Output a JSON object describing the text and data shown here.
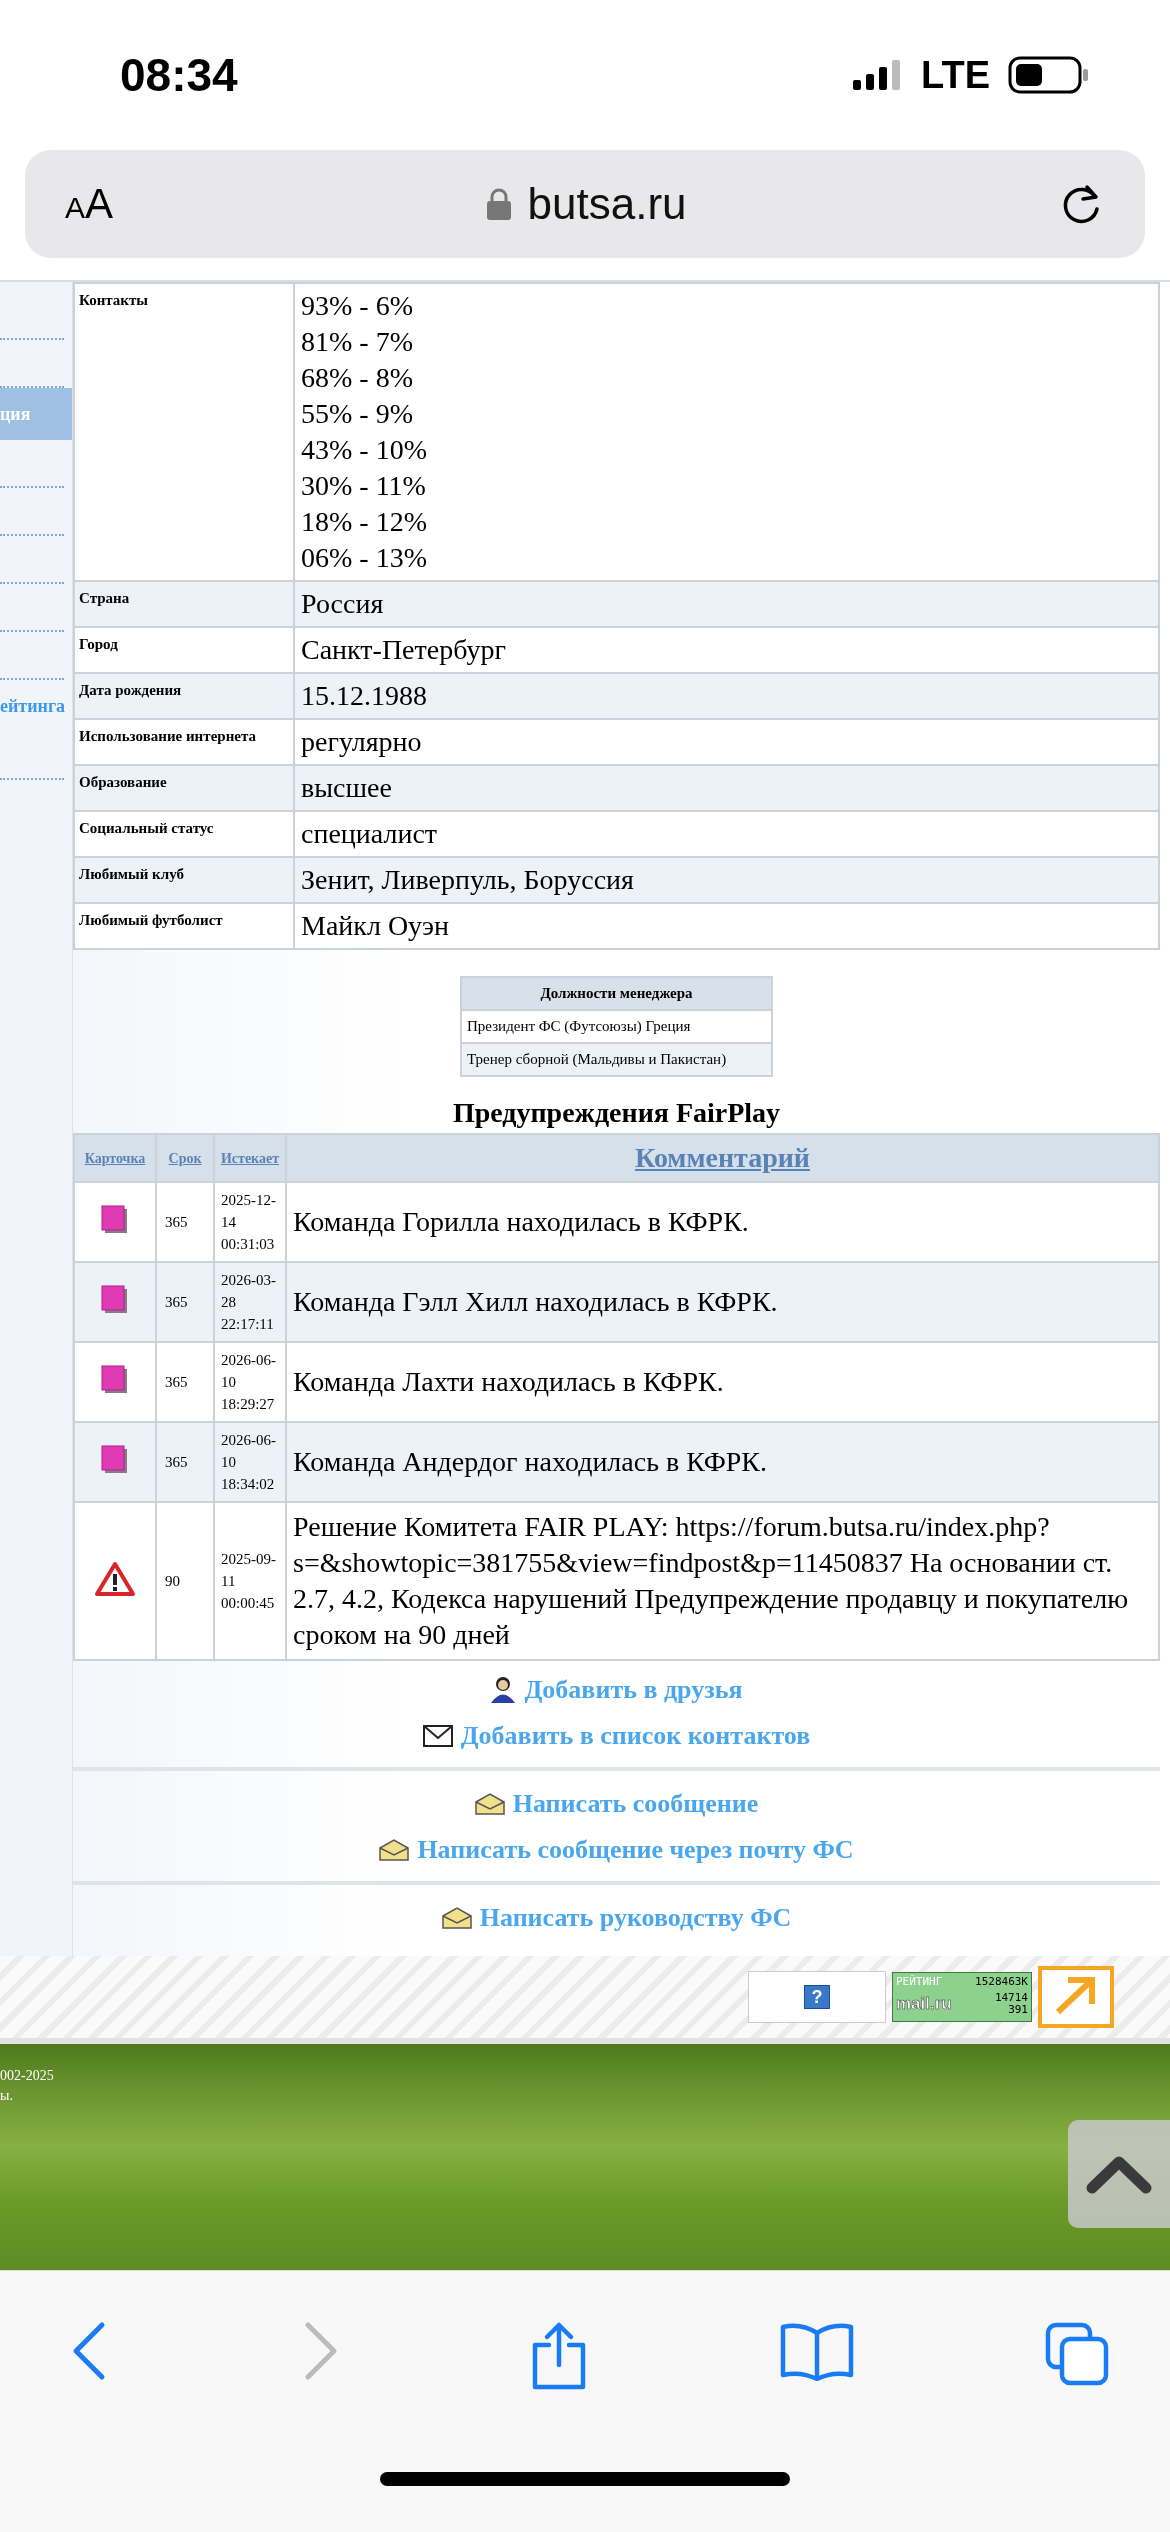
{
  "status_bar": {
    "time": "08:34",
    "network": "LTE"
  },
  "browser": {
    "text_size_button": "AA",
    "url": "butsa.ru"
  },
  "sidebar": {
    "items": [
      {
        "label": "ция",
        "selected": true
      },
      {
        "label": "ейтинга",
        "selected": false
      }
    ]
  },
  "profile": {
    "rows": [
      {
        "label": "Контакты",
        "values": [
          "93% - 6%",
          "81% - 7%",
          "68% - 8%",
          "55% - 9%",
          "43% - 10%",
          "30% - 11%",
          "18% - 12%",
          "06% - 13%"
        ]
      },
      {
        "label": "Страна",
        "values": [
          "Россия"
        ]
      },
      {
        "label": "Город",
        "values": [
          "Санкт-Петербург"
        ]
      },
      {
        "label": "Дата рождения",
        "values": [
          "15.12.1988"
        ]
      },
      {
        "label": "Использование интернета",
        "values": [
          "регулярно"
        ]
      },
      {
        "label": "Образование",
        "values": [
          "высшее"
        ]
      },
      {
        "label": "Социальный статус",
        "values": [
          "специалист"
        ]
      },
      {
        "label": "Любимый клуб",
        "values": [
          "Зенит, Ливерпуль, Боруссия"
        ]
      },
      {
        "label": "Любимый футболист",
        "values": [
          "Майкл Оуэн"
        ]
      }
    ]
  },
  "manager_posts": {
    "title": "Должности менеджера",
    "items": [
      "Президент ФС (Футсоюзы) Греция",
      "Тренер сборной (Мальдивы и Пакистан)"
    ]
  },
  "fairplay": {
    "title": "Предупреждения FairPlay",
    "columns": [
      "Карточка",
      "Срок",
      "Истекает",
      "Комментарий"
    ],
    "rows": [
      {
        "kind": "card",
        "term": "365",
        "expires": "2025-12-14 00:31:03",
        "comment": "Команда Горилла находилась в КФРК."
      },
      {
        "kind": "card",
        "term": "365",
        "expires": "2026-03-28 22:17:11",
        "comment": "Команда Гэлл Хилл находилась в КФРК."
      },
      {
        "kind": "card",
        "term": "365",
        "expires": "2026-06-10 18:29:27",
        "comment": "Команда Лахти находилась в КФРК."
      },
      {
        "kind": "card",
        "term": "365",
        "expires": "2026-06-10 18:34:02",
        "comment": "Команда Андердог находилась в КФРК."
      },
      {
        "kind": "warning",
        "term": "90",
        "expires": "2025-09-11 00:00:45",
        "comment": "Решение Комитета FAIR PLAY: https://forum.butsa.ru/index.php?s=&showtopic=381755&view=findpost&p=11450837 На основании ст. 2.7, 4.2, Кодекса нарушений Предупреждение продавцу и покупателю сроком на 90 дней"
      }
    ]
  },
  "action_groups": [
    [
      {
        "kind": "person",
        "label": "Добавить в друзья"
      },
      {
        "kind": "envelope",
        "label": "Добавить в список контактов"
      }
    ],
    [
      {
        "kind": "open-envelope",
        "label": "Написать сообщение"
      },
      {
        "kind": "open-envelope",
        "label": "Написать сообщение через почту ФС"
      }
    ],
    [
      {
        "kind": "open-envelope",
        "label": "Написать руководству ФС"
      }
    ]
  ],
  "footer": {
    "help": "?",
    "rating": {
      "title": "РЕЙТИНГ",
      "total": "1528463K",
      "brand": "mail.ru",
      "hits": "14714",
      "hosts": "391"
    },
    "copyright": [
      "002-2025",
      "ы."
    ]
  },
  "toolbar": [
    {
      "kind": "back",
      "disabled": false
    },
    {
      "kind": "forward",
      "disabled": true
    },
    {
      "kind": "share",
      "disabled": false
    },
    {
      "kind": "bookmarks",
      "disabled": false
    },
    {
      "kind": "tabs",
      "disabled": false
    }
  ]
}
